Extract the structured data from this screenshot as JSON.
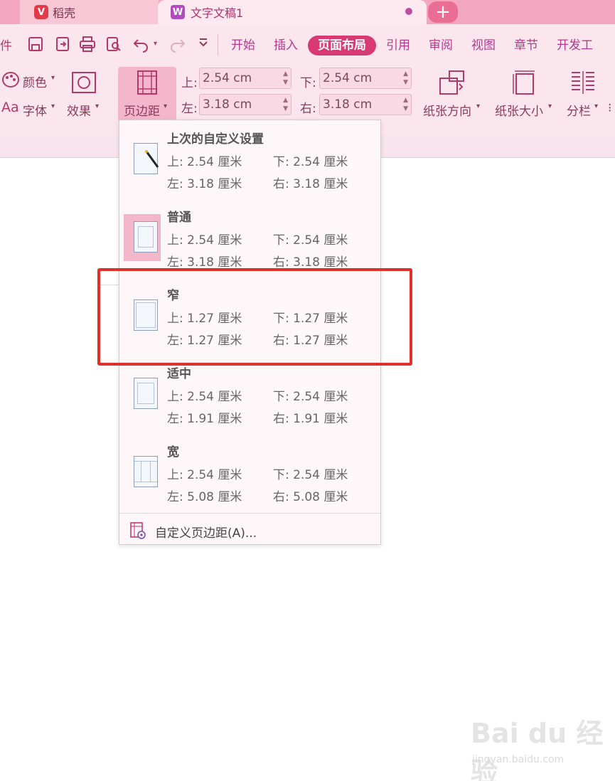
{
  "tabs": {
    "inactive_tab": "稻壳",
    "active_tab": "文字文稿1",
    "add_tab_symbol": "+"
  },
  "quick_access": {
    "left_cut_text": "件",
    "icons": [
      "save-icon",
      "export-icon",
      "print-icon",
      "preview-icon",
      "undo-icon",
      "redo-icon",
      "more-icon"
    ]
  },
  "menu": {
    "items": [
      "开始",
      "插入",
      "页面布局",
      "引用",
      "审阅",
      "视图",
      "章节",
      "开发工"
    ],
    "active_index": 2
  },
  "ribbon": {
    "color_label": "颜色",
    "font_label": "字体",
    "effect_label": "效果",
    "margins_button": "页边距",
    "top_label": "上:",
    "top_value": "2.54 cm",
    "bottom_label": "下:",
    "bottom_value": "2.54 cm",
    "left_label": "左:",
    "left_value": "3.18 cm",
    "right_label": "右:",
    "right_value": "3.18 cm",
    "orientation_label": "纸张方向",
    "size_label": "纸张大小",
    "columns_label": "分栏",
    "aa_glyph": "Aa",
    "dropdown_caret": "▾"
  },
  "margin_presets": [
    {
      "name": "上次的自定义设置",
      "top": "上: 2.54 厘米",
      "bottom": "下: 2.54 厘米",
      "left": "左: 3.18 厘米",
      "right": "右: 3.18 厘米"
    },
    {
      "name": "普通",
      "top": "上: 2.54 厘米",
      "bottom": "下: 2.54 厘米",
      "left": "左: 3.18 厘米",
      "right": "右: 3.18 厘米"
    },
    {
      "name": "窄",
      "top": "上: 1.27 厘米",
      "bottom": "下: 1.27 厘米",
      "left": "左: 1.27 厘米",
      "right": "右: 1.27 厘米"
    },
    {
      "name": "适中",
      "top": "上: 2.54 厘米",
      "bottom": "下: 2.54 厘米",
      "left": "左: 1.91 厘米",
      "right": "右: 1.91 厘米"
    },
    {
      "name": "宽",
      "top": "上: 2.54 厘米",
      "bottom": "下: 2.54 厘米",
      "left": "左: 5.08 厘米",
      "right": "右: 5.08 厘米"
    }
  ],
  "custom_margins": "自定义页边距(A)...",
  "watermark": {
    "main": "Bai du 经验",
    "sub": "jingyan.baidu.com"
  },
  "colors": {
    "accent": "#d83a72",
    "highlight": "#e0302a",
    "tabbar": "#f2a6bf"
  }
}
